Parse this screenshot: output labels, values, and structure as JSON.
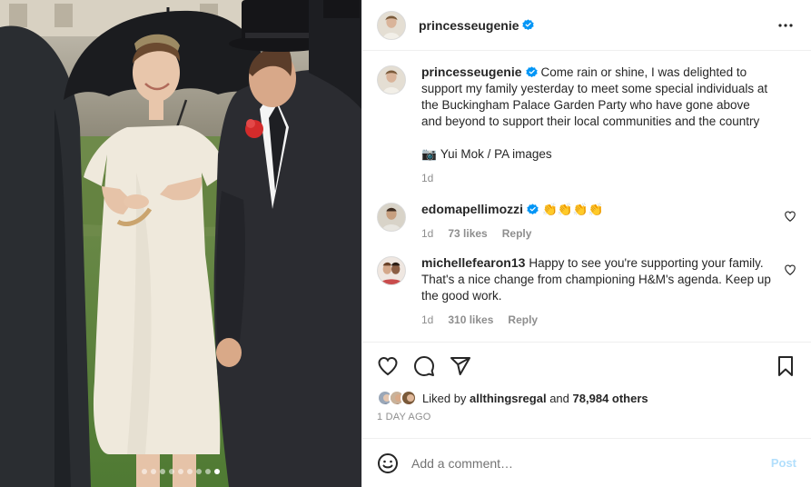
{
  "post": {
    "author": {
      "username": "princesseugenie",
      "verified": true
    },
    "caption": {
      "username": "princesseugenie",
      "text": "Come rain or shine, I was delighted to support my family yesterday to meet some special individuals at the Buckingham Palace Garden Party who have gone above and beyond to support their local communities and the country",
      "credit_icon": "camera-emoji",
      "credit_symbol": "📷",
      "credit": "Yui Mok / PA images",
      "time": "1d"
    },
    "comments": [
      {
        "username": "edomapellimozzi",
        "verified": true,
        "text": "👏👏👏👏",
        "time": "1d",
        "likes": "73 likes",
        "reply_label": "Reply"
      },
      {
        "username": "michellefearon13",
        "verified": false,
        "text": "Happy to see you're supporting your family. That's a nice change from championing H&M's agenda. Keep up the good work.",
        "time": "1d",
        "likes": "310 likes",
        "reply_label": "Reply"
      }
    ],
    "likes": {
      "prefix": "Liked by",
      "liked_by": "allthingsregal",
      "connector": "and",
      "others": "78,984 others"
    },
    "posted_ago": "1 DAY AGO",
    "add_comment": {
      "placeholder": "Add a comment…",
      "post_label": "Post"
    },
    "carousel": {
      "count": 9,
      "active_index": 8
    },
    "icons": {
      "more": "more-options-icon",
      "like": "heart-icon",
      "comment": "comment-icon",
      "share": "share-icon",
      "save": "bookmark-icon",
      "emoji": "emoji-icon",
      "verified": "verified-badge-icon"
    },
    "colors": {
      "verified": "#0095f6",
      "post_button_disabled": "#b2dffc",
      "secondary_text": "#8e8e8e"
    }
  }
}
